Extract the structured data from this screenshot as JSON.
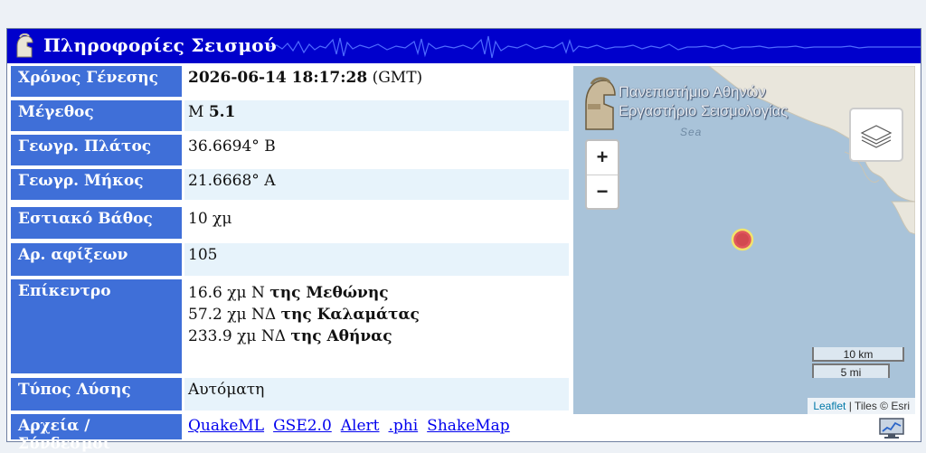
{
  "header": {
    "title": "Πληροφορίες Σεισμού"
  },
  "colors": {
    "header_bg": "#0000cc",
    "label_bg": "#3f6fd8",
    "row_shade": "#e7f3fb",
    "marker": "#e0565c"
  },
  "rows": {
    "origin_time": {
      "label": "Χρόνος Γένεσης",
      "value_bold": "2026-06-14 18:17:28",
      "value_suffix": " (GMT)"
    },
    "magnitude": {
      "label": "Μέγεθος",
      "prefix": "M ",
      "value": "5.1"
    },
    "latitude": {
      "label": "Γεωγρ. Πλάτος",
      "value": "36.6694° Β"
    },
    "longitude": {
      "label": "Γεωγρ. Μήκος",
      "value": "21.6668° Α"
    },
    "depth": {
      "label": "Εστιακό Βάθος",
      "value": "10 χμ"
    },
    "arrivals": {
      "label": "Αρ. αφίξεων",
      "value": "105"
    },
    "epicenter": {
      "label": "Επίκεντρο",
      "lines": [
        {
          "dist": "16.6 χμ Ν ",
          "place": "της Μεθώνης"
        },
        {
          "dist": "57.2 χμ ΝΔ ",
          "place": "της Καλαμάτας"
        },
        {
          "dist": "233.9 χμ ΝΔ ",
          "place": "της Αθήνας"
        }
      ]
    },
    "solution_type": {
      "label": "Τύπος Λύσης",
      "value": "Αυτόματη"
    },
    "files": {
      "label": "Αρχεία / Σύνδεσμοι",
      "links": [
        "QuakeML",
        "GSE2.0",
        "Alert",
        ".phi",
        "ShakeMap"
      ]
    }
  },
  "map": {
    "logo_line1": "Πανεπιστήμιο Αθηνών",
    "logo_line2": "Εργαστήριο Σεισμολογίας",
    "sea_label": "Sea",
    "zoom_in": "+",
    "zoom_out": "−",
    "scale_km": "10 km",
    "scale_mi": "5 mi",
    "attribution_link": "Leaflet",
    "attribution_text": " | Tiles © Esri",
    "icons": {
      "layers": "layers-icon",
      "monitor": "monitor-chart-icon",
      "helmet": "helmet-icon"
    }
  }
}
